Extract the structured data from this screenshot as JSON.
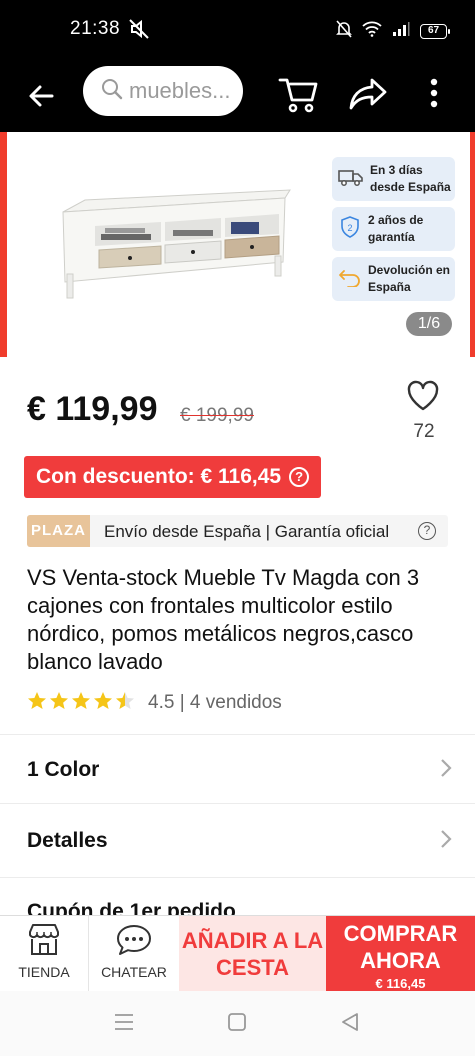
{
  "status": {
    "time": "21:38",
    "battery": "67"
  },
  "search": {
    "query": "muebles..."
  },
  "gallery": {
    "features": [
      {
        "icon": "truck-icon",
        "text": "En 3 días desde España"
      },
      {
        "icon": "shield-icon",
        "shield_number": "2",
        "text": "2 años de garantía"
      },
      {
        "icon": "return-icon",
        "text": "Devolución en España"
      }
    ],
    "counter": "1/6"
  },
  "price": {
    "current": "€ 119,99",
    "original": "€ 199,99",
    "wishlist_count": "72"
  },
  "discount": {
    "label": "Con descuento: € 116,45",
    "help_symbol": "?"
  },
  "plaza": {
    "tag": "PLAZA",
    "text": "Envío desde España | Garantía oficial",
    "help_symbol": "?"
  },
  "product": {
    "title": "VS Venta-stock Mueble Tv Magda con 3 cajones con frontales multicolor estilo nórdico, pomos metálicos negros,casco blanco lavado"
  },
  "rating": {
    "value": 4.5,
    "text": "4.5 | 4 vendidos"
  },
  "rows": {
    "color": "1 Color",
    "details": "Detalles",
    "coupon": "Cupón de 1er pedido"
  },
  "actions": {
    "store": "TIENDA",
    "chat": "CHATEAR",
    "add_to_cart": "AÑADIR A LA CESTA",
    "buy_now": "COMPRAR AHORA",
    "buy_price": "€ 116,45"
  },
  "colors": {
    "accent": "#f03c3c",
    "plaza_tag": "#e8c49a",
    "star": "#f5c518",
    "feature_bg": "#e6eef8"
  }
}
